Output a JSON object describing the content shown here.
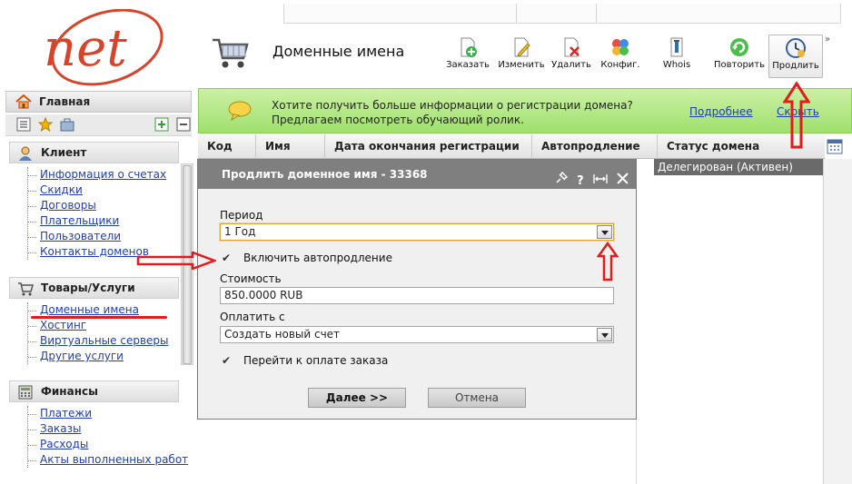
{
  "app": {
    "logo_text": "net",
    "page_title": "Доменные имена"
  },
  "toolbar": {
    "buttons": [
      {
        "label": "Заказать",
        "icon": "add-document-icon"
      },
      {
        "label": "Изменить",
        "icon": "edit-document-icon"
      },
      {
        "label": "Удалить",
        "icon": "delete-document-icon"
      },
      {
        "label": "Конфиг.",
        "icon": "config-icon"
      },
      {
        "label": "Whois",
        "icon": "whois-icon"
      },
      {
        "label": "Повторить",
        "icon": "repeat-icon"
      },
      {
        "label": "Продлить",
        "icon": "renew-clock-icon"
      }
    ],
    "more": "»"
  },
  "sidebar": {
    "home_label": "Главная",
    "sections": [
      {
        "title": "Клиент",
        "items": [
          "Информация о счетах",
          "Скидки",
          "Договоры",
          "Плательщики",
          "Пользователи",
          "Контакты доменов"
        ]
      },
      {
        "title": "Товары/Услуги",
        "items": [
          "Доменные имена",
          "Хостинг",
          "Виртуальные серверы",
          "Другие услуги"
        ]
      },
      {
        "title": "Финансы",
        "items": [
          "Платежи",
          "Заказы",
          "Расходы",
          "Акты выполненных работ"
        ]
      }
    ]
  },
  "banner": {
    "line1": "Хотите получить больше информации о регистрации домена?",
    "line2": "Предлагаем посмотреть обучающий ролик.",
    "more_link": "Подробнее",
    "hide_link": "Скрыть"
  },
  "table": {
    "columns": [
      "Код",
      "Имя",
      "Дата окончания регистрации",
      "Автопродление",
      "Статус домена"
    ],
    "rows": [
      {
        "status": "Делегирован (Активен)"
      }
    ]
  },
  "dialog": {
    "title": "Продлить доменное имя - 33368",
    "period_label": "Период",
    "period_value": "1 Год",
    "autorenew_label": "Включить автопродление",
    "autorenew_checked": "✔",
    "cost_label": "Стоимость",
    "cost_value": "850.0000 RUB",
    "pay_label": "Оплатить с",
    "pay_value": "Создать новый счет",
    "goto_payment_label": "Перейти к оплате заказа",
    "goto_payment_checked": "✔",
    "next_button": "Далее >>",
    "cancel_button": "Отмена"
  },
  "colors": {
    "link": "#1f3fb0",
    "banner_bg": "#aee57c",
    "dialog_header": "#7f7f7f",
    "annotation_red": "#e21b1b"
  }
}
